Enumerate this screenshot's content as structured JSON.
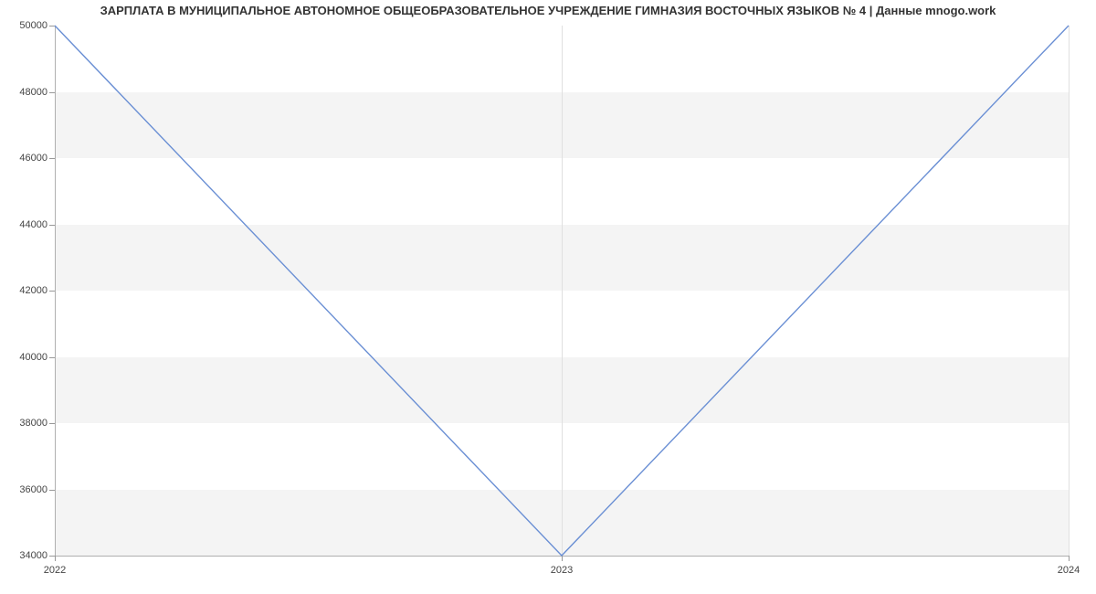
{
  "chart_data": {
    "type": "line",
    "title": "ЗАРПЛАТА В МУНИЦИПАЛЬНОЕ АВТОНОМНОЕ ОБЩЕОБРАЗОВАТЕЛЬНОЕ УЧРЕЖДЕНИЕ ГИМНАЗИЯ ВОСТОЧНЫХ ЯЗЫКОВ № 4 | Данные mnogo.work",
    "x": [
      "2022",
      "2023",
      "2024"
    ],
    "values": [
      50000,
      34000,
      50000
    ],
    "xlabel": "",
    "ylabel": "",
    "ylim": [
      34000,
      50000
    ],
    "y_ticks": [
      34000,
      36000,
      38000,
      40000,
      42000,
      44000,
      46000,
      48000,
      50000
    ],
    "line_color": "#6a8fd4"
  }
}
